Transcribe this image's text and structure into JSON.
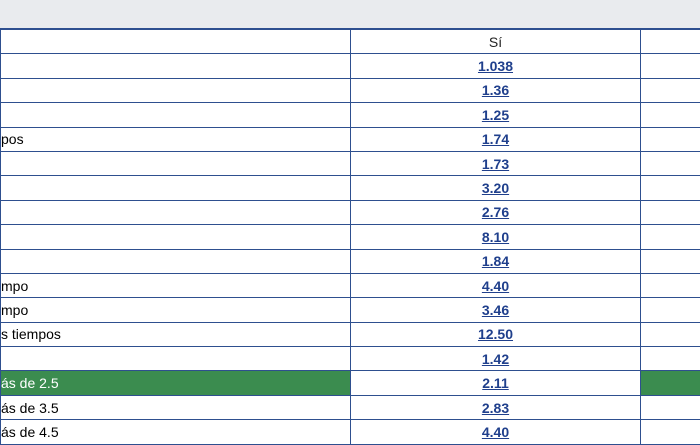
{
  "header": {
    "yes_label": "Sí",
    "label_header": "",
    "extra_header": ""
  },
  "rows": [
    {
      "label": "",
      "odds": "1.038",
      "highlight": false
    },
    {
      "label": "",
      "odds": "1.36",
      "highlight": false
    },
    {
      "label": "",
      "odds": "1.25",
      "highlight": false
    },
    {
      "label": "pos",
      "odds": "1.74",
      "highlight": false
    },
    {
      "label": "",
      "odds": "1.73",
      "highlight": false
    },
    {
      "label": "",
      "odds": "3.20",
      "highlight": false
    },
    {
      "label": "",
      "odds": "2.76",
      "highlight": false
    },
    {
      "label": "",
      "odds": "8.10",
      "highlight": false
    },
    {
      "label": "",
      "odds": "1.84",
      "highlight": false
    },
    {
      "label": "mpo",
      "odds": "4.40",
      "highlight": false
    },
    {
      "label": "mpo",
      "odds": "3.46",
      "highlight": false
    },
    {
      "label": "s tiempos",
      "odds": "12.50",
      "highlight": false
    },
    {
      "label": "",
      "odds": "1.42",
      "highlight": false
    },
    {
      "label": "ás de 2.5",
      "odds": "2.11",
      "highlight": true
    },
    {
      "label": "ás de 3.5",
      "odds": "2.83",
      "highlight": false
    },
    {
      "label": "ás de 4.5",
      "odds": "4.40",
      "highlight": false
    }
  ],
  "colors": {
    "border": "#2e4f8f",
    "link": "#1f3f8c",
    "highlight": "#3b8c4f",
    "top_band": "#e9ebee"
  }
}
